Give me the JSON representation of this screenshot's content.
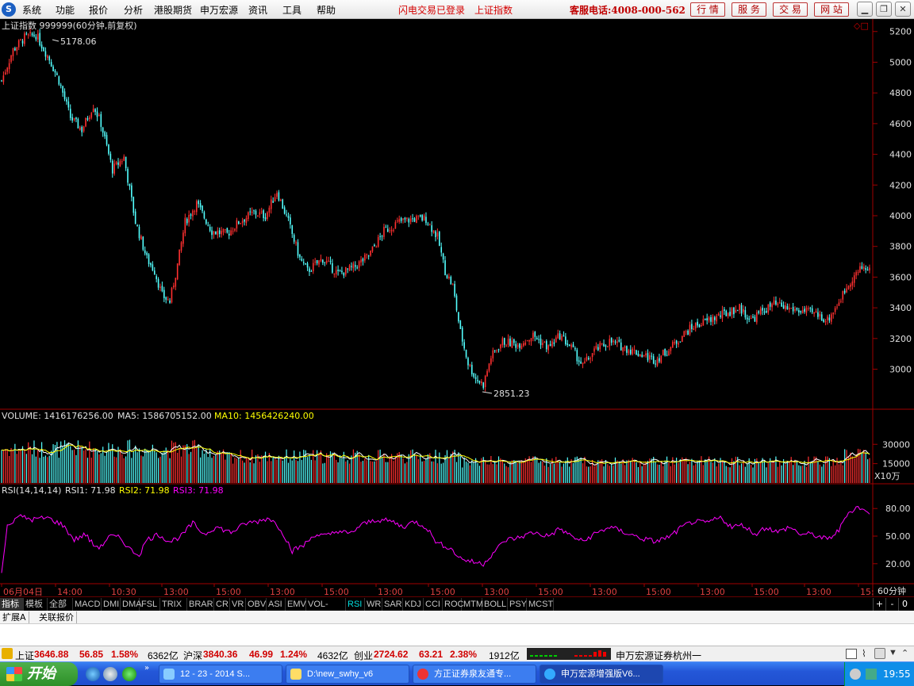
{
  "menubar": {
    "logo": "S",
    "items": [
      "系统",
      "功能",
      "报价",
      "分析",
      "港股期货",
      "申万宏源",
      "资讯",
      "工具",
      "帮助"
    ],
    "status_login": "闪电交易已登录",
    "status_index": "上证指数",
    "hotline": "客服电话:4008-000-562",
    "buttons": [
      "行 情",
      "服 务",
      "交 易",
      "网 站"
    ],
    "window_controls": [
      "minimize-icon",
      "restore-icon",
      "close-icon"
    ]
  },
  "chart_header": {
    "title": "上证指数 999999(60分钟,前复权)",
    "max_label": "5178.06",
    "min_label": "2851.23"
  },
  "volume_header": {
    "label": "VOLUME: 1416176256.00",
    "ma5": "MA5: 1586705152.00",
    "ma10": "MA10: 1456426240.00",
    "unit": "X10万"
  },
  "rsi_header": {
    "label": "RSI(14,14,14)",
    "rsi1": "RSI1: 71.98",
    "rsi2": "RSI2: 71.98",
    "rsi3": "RSI3: 71.98"
  },
  "chart_data": {
    "type": "candlestick",
    "price_axis_ticks": [
      5200,
      5000,
      4800,
      4600,
      4400,
      4200,
      4000,
      3800,
      3600,
      3400,
      3200,
      3000
    ],
    "price_range": [
      2760,
      5240
    ],
    "volume_axis_ticks": [
      "30000",
      "15000"
    ],
    "volume_range": [
      0,
      40000
    ],
    "rsi_axis_ticks": [
      "80.00",
      "50.00",
      "20.00"
    ],
    "rsi_range": [
      0,
      100
    ],
    "x_tick_labels": [
      "06月04日",
      "14:00",
      "10:30",
      "13:00",
      "15:00",
      "13:00",
      "15:00",
      "13:00",
      "15:00",
      "13:00",
      "15:00",
      "13:00",
      "15:00",
      "13:00",
      "15:00",
      "13:00",
      "15:"
    ],
    "period_label": "60分钟",
    "price_keypoints": [
      [
        0,
        4880
      ],
      [
        6,
        5080
      ],
      [
        12,
        5160
      ],
      [
        18,
        5178
      ],
      [
        25,
        5020
      ],
      [
        30,
        4880
      ],
      [
        36,
        4640
      ],
      [
        42,
        4560
      ],
      [
        48,
        4720
      ],
      [
        52,
        4600
      ],
      [
        58,
        4300
      ],
      [
        64,
        4380
      ],
      [
        70,
        3960
      ],
      [
        76,
        3720
      ],
      [
        80,
        3640
      ],
      [
        84,
        3480
      ],
      [
        88,
        3440
      ],
      [
        92,
        3680
      ],
      [
        96,
        3960
      ],
      [
        102,
        4080
      ],
      [
        110,
        3900
      ],
      [
        118,
        3880
      ],
      [
        124,
        3960
      ],
      [
        132,
        4020
      ],
      [
        138,
        4000
      ],
      [
        144,
        4160
      ],
      [
        150,
        3960
      ],
      [
        156,
        3720
      ],
      [
        160,
        3640
      ],
      [
        168,
        3720
      ],
      [
        176,
        3620
      ],
      [
        184,
        3660
      ],
      [
        192,
        3740
      ],
      [
        200,
        3900
      ],
      [
        208,
        3960
      ],
      [
        216,
        3980
      ],
      [
        222,
        3980
      ],
      [
        228,
        3860
      ],
      [
        232,
        3640
      ],
      [
        236,
        3540
      ],
      [
        240,
        3240
      ],
      [
        244,
        3040
      ],
      [
        248,
        2940
      ],
      [
        252,
        2900
      ],
      [
        256,
        3080
      ],
      [
        262,
        3180
      ],
      [
        270,
        3160
      ],
      [
        278,
        3220
      ],
      [
        286,
        3140
      ],
      [
        292,
        3220
      ],
      [
        298,
        3140
      ],
      [
        304,
        3020
      ],
      [
        310,
        3120
      ],
      [
        318,
        3180
      ],
      [
        326,
        3140
      ],
      [
        334,
        3100
      ],
      [
        342,
        3060
      ],
      [
        350,
        3140
      ],
      [
        356,
        3220
      ],
      [
        362,
        3280
      ],
      [
        370,
        3320
      ],
      [
        378,
        3360
      ],
      [
        386,
        3400
      ],
      [
        392,
        3320
      ],
      [
        398,
        3380
      ],
      [
        404,
        3420
      ],
      [
        410,
        3400
      ],
      [
        418,
        3380
      ],
      [
        426,
        3360
      ],
      [
        432,
        3320
      ],
      [
        438,
        3440
      ],
      [
        444,
        3580
      ],
      [
        450,
        3660
      ]
    ],
    "rsi_keypoints": [
      [
        0,
        10
      ],
      [
        3,
        60
      ],
      [
        8,
        72
      ],
      [
        16,
        68
      ],
      [
        24,
        70
      ],
      [
        32,
        62
      ],
      [
        38,
        46
      ],
      [
        44,
        52
      ],
      [
        48,
        40
      ],
      [
        52,
        38
      ],
      [
        56,
        50
      ],
      [
        62,
        48
      ],
      [
        68,
        34
      ],
      [
        72,
        30
      ],
      [
        76,
        46
      ],
      [
        82,
        52
      ],
      [
        88,
        44
      ],
      [
        94,
        50
      ],
      [
        100,
        64
      ],
      [
        106,
        52
      ],
      [
        112,
        60
      ],
      [
        120,
        54
      ],
      [
        128,
        64
      ],
      [
        134,
        66
      ],
      [
        140,
        70
      ],
      [
        146,
        58
      ],
      [
        152,
        34
      ],
      [
        158,
        40
      ],
      [
        164,
        52
      ],
      [
        170,
        50
      ],
      [
        176,
        56
      ],
      [
        182,
        52
      ],
      [
        188,
        62
      ],
      [
        196,
        68
      ],
      [
        204,
        66
      ],
      [
        210,
        60
      ],
      [
        216,
        66
      ],
      [
        222,
        60
      ],
      [
        228,
        42
      ],
      [
        234,
        38
      ],
      [
        240,
        26
      ],
      [
        246,
        22
      ],
      [
        252,
        20
      ],
      [
        258,
        34
      ],
      [
        264,
        46
      ],
      [
        270,
        48
      ],
      [
        278,
        54
      ],
      [
        286,
        50
      ],
      [
        292,
        58
      ],
      [
        298,
        50
      ],
      [
        304,
        44
      ],
      [
        310,
        52
      ],
      [
        318,
        60
      ],
      [
        326,
        54
      ],
      [
        334,
        48
      ],
      [
        342,
        44
      ],
      [
        350,
        50
      ],
      [
        356,
        60
      ],
      [
        362,
        66
      ],
      [
        368,
        64
      ],
      [
        376,
        70
      ],
      [
        382,
        60
      ],
      [
        388,
        62
      ],
      [
        394,
        52
      ],
      [
        400,
        60
      ],
      [
        406,
        54
      ],
      [
        412,
        60
      ],
      [
        418,
        52
      ],
      [
        424,
        52
      ],
      [
        432,
        46
      ],
      [
        438,
        56
      ],
      [
        442,
        74
      ],
      [
        448,
        82
      ],
      [
        452,
        76
      ]
    ]
  },
  "indicator_tabs": [
    "指标",
    "模板",
    "全部",
    "MACD",
    "DMI",
    "DMA",
    "FSL",
    "TRIX",
    "BRAR",
    "CR",
    "VR",
    "OBV",
    "ASI",
    "EMV",
    "VOL-TDX",
    "RSI",
    "WR",
    "SAR",
    "KDJ",
    "CCI",
    "ROC",
    "MTM",
    "BOLL",
    "PSY",
    "MCST"
  ],
  "indicator_controls": [
    "+",
    "-",
    "0"
  ],
  "ext_tabs": [
    "扩展A",
    "关联报价"
  ],
  "ticker": {
    "sh_label": "上证",
    "sh_value": "3646.88",
    "sh_change": "56.85",
    "sh_pct": "1.58%",
    "sh_amount": "6362亿",
    "hs_label": "沪深",
    "hs_value": "3840.36",
    "hs_change": "46.99",
    "hs_pct": "1.24%",
    "hs_amount": "4632亿",
    "cy_label": "创业",
    "cy_value": "2724.62",
    "cy_change": "63.21",
    "cy_pct": "2.38%",
    "cy_amount": "1912亿",
    "broker": "申万宏源证券杭州一"
  },
  "taskbar": {
    "start": "开始",
    "tasks": [
      "12 - 23 - 2014 S...",
      "D:\\new_swhy_v6",
      "方正证券泉友通专...",
      "申万宏源增强版V6..."
    ],
    "clock": "19:55"
  }
}
